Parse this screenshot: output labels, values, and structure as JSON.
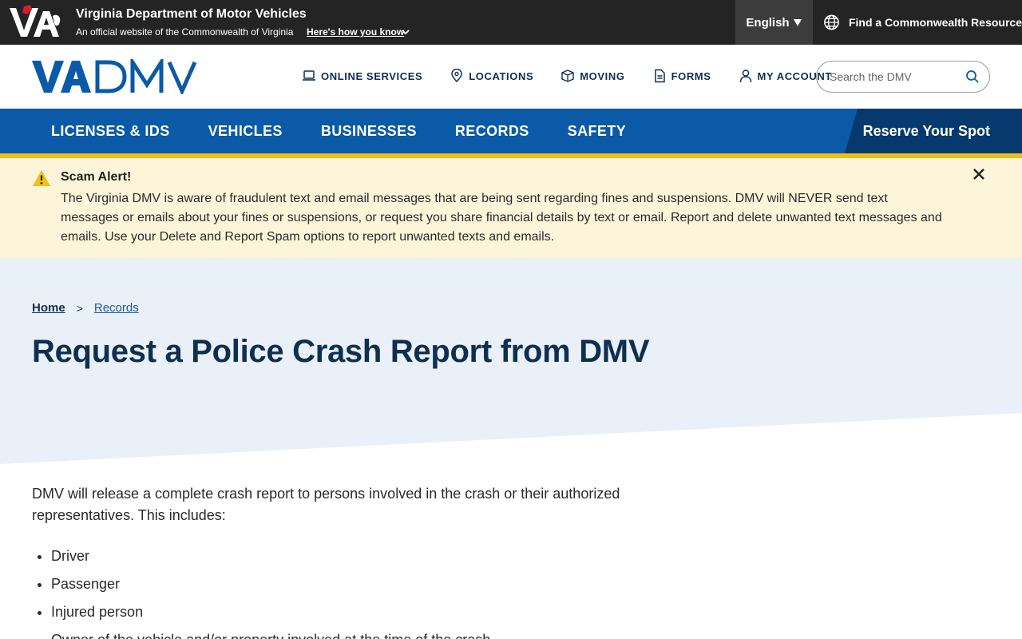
{
  "gov_bar": {
    "title": "Virginia Department of Motor Vehicles",
    "subtitle": "An official website of the Commonwealth of Virginia",
    "how_link": "Here's how you know",
    "language": "English",
    "commonwealth_resource": "Find a Commonwealth Resource"
  },
  "header": {
    "logo_text": "VADMV",
    "util_nav": [
      {
        "label": "ONLINE SERVICES",
        "icon": "laptop-icon"
      },
      {
        "label": "LOCATIONS",
        "icon": "map-pin-icon"
      },
      {
        "label": "MOVING",
        "icon": "moving-box-icon"
      },
      {
        "label": "FORMS",
        "icon": "document-icon"
      },
      {
        "label": "MY ACCOUNT",
        "icon": "user-icon"
      }
    ],
    "search_placeholder": "Search the DMV"
  },
  "main_nav": {
    "items": [
      "LICENSES & IDS",
      "VEHICLES",
      "BUSINESSES",
      "RECORDS",
      "SAFETY"
    ],
    "reserve": "Reserve Your Spot"
  },
  "alert": {
    "title": "Scam Alert!",
    "body": "The Virginia DMV is aware of fraudulent text and email messages that are being sent regarding fines and suspensions. DMV will NEVER send text messages or emails about your fines or suspensions, or request you share financial details by text or email. Report and delete unwanted text messages and emails. Use your Delete and Report Spam options to report unwanted texts and emails."
  },
  "breadcrumb": {
    "home": "Home",
    "separator": ">",
    "current": "Records"
  },
  "page_title": "Request a Police Crash Report from DMV",
  "content": {
    "intro": "DMV will release a complete crash report to persons involved in the crash or their authorized representatives. This includes:",
    "list": [
      "Driver",
      "Passenger",
      "Injured person",
      "Owner of the vehicle and/or property involved at the time of the crash"
    ]
  },
  "colors": {
    "gov_bar": "#242424",
    "primary_blue": "#0a5aa8",
    "dark_navy": "#0f2f4f",
    "gold": "#f1be1a",
    "alert_bg": "#fdf5d9",
    "hero_bg": "#eaf0f7"
  }
}
